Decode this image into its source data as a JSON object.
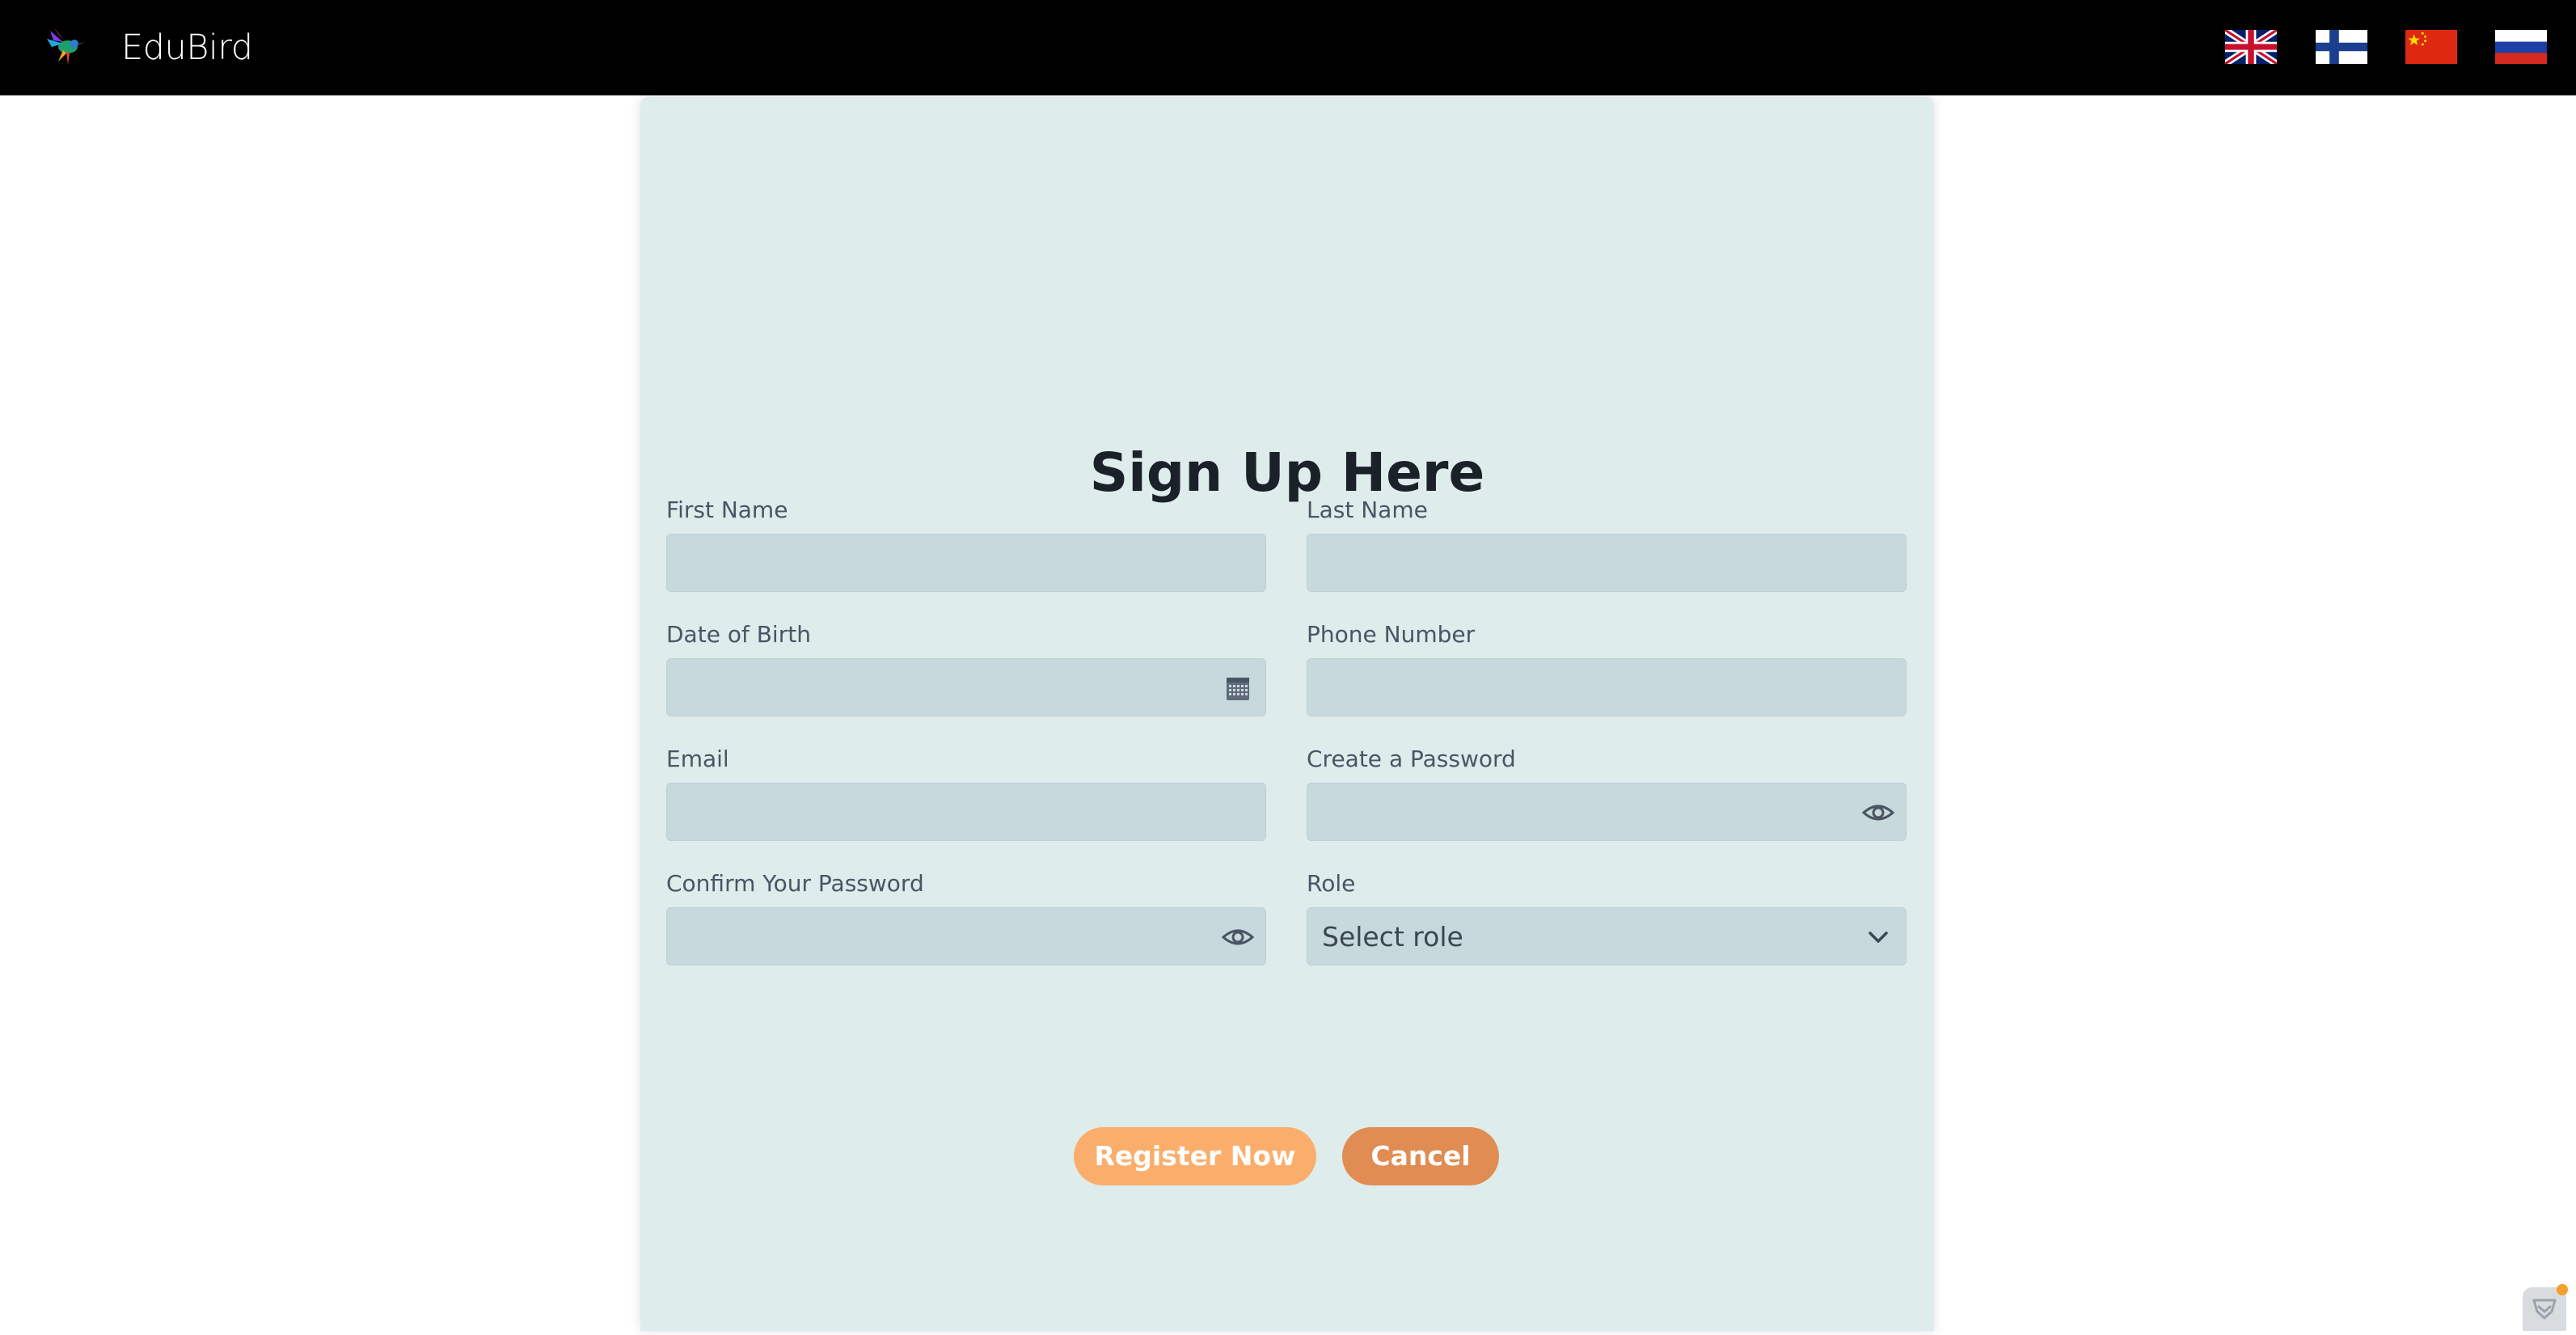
{
  "brand": {
    "name": "EduBird",
    "logo_icon": "hummingbird-logo-icon"
  },
  "languages": [
    {
      "code": "en",
      "icon": "uk-flag-icon"
    },
    {
      "code": "fi",
      "icon": "finland-flag-icon"
    },
    {
      "code": "zh",
      "icon": "china-flag-icon"
    },
    {
      "code": "ru",
      "icon": "russia-flag-icon"
    }
  ],
  "form": {
    "title": "Sign Up Here",
    "first_name": {
      "label": "First Name",
      "value": ""
    },
    "last_name": {
      "label": "Last Name",
      "value": ""
    },
    "date_of_birth": {
      "label": "Date of Birth",
      "value": "",
      "icon": "calendar-icon"
    },
    "phone_number": {
      "label": "Phone Number",
      "value": ""
    },
    "email": {
      "label": "Email",
      "value": ""
    },
    "create_password": {
      "label": "Create a Password",
      "value": "",
      "icon": "eye-icon"
    },
    "confirm_password": {
      "label": "Confirm Your Password",
      "value": "",
      "icon": "eye-icon"
    },
    "role": {
      "label": "Role",
      "selected": "Select role",
      "icon": "chevron-down-icon"
    },
    "register_button": "Register Now",
    "cancel_button": "Cancel"
  },
  "colors": {
    "navbar": "#000000",
    "card_background": "#deecec",
    "input_background": "#c8d9dd",
    "register_button": "#fbae6c",
    "cancel_button": "#e08c52"
  }
}
